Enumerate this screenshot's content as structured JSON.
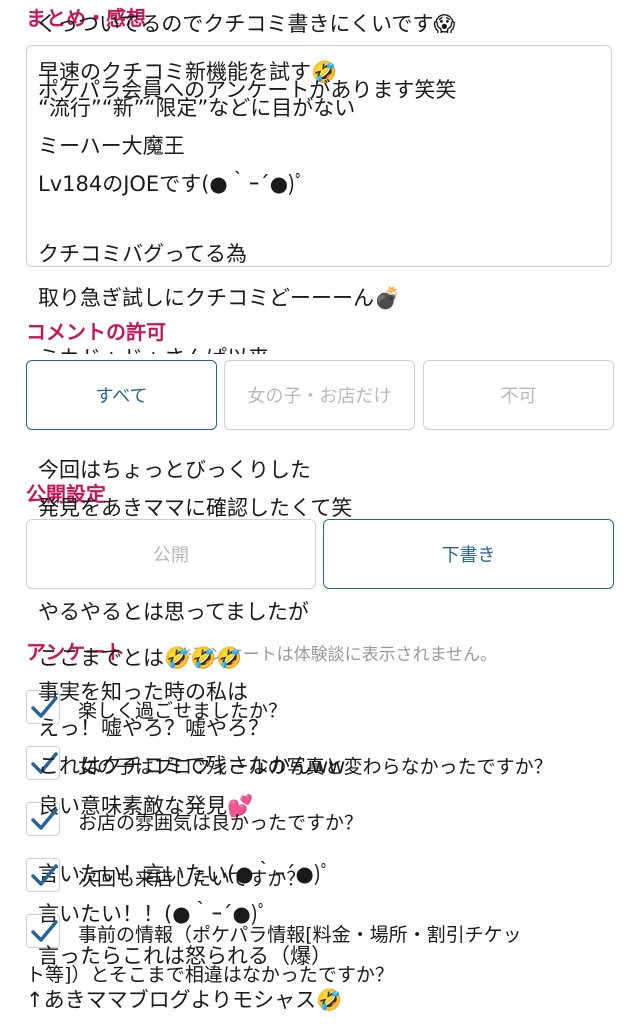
{
  "sections": {
    "summary_heading": "まとめ・感想",
    "comment_heading": "コメントの許可",
    "publish_heading": "公開設定",
    "survey_heading": "アンケート"
  },
  "review_lines": [
    "くっついてるのでクチコミ書きにくいです😱",
    "早速のクチコミ新機能を試す🤣",
    "ポケパラ会員へのアンケートがあります笑笑",
    "“流行”“新”“限定”などに目がない",
    "ミーハー大魔王",
    "Lv184のJOEです(●｀ｰ´●)ﾟ",
    "クチコミバグってる為",
    "取り急ぎ試しにクチコミどーーーん💣",
    "ミカドゥドゥさんぱ以来",
    "今回はちょっとびっくりした",
    "発見をあきママに確認したくて笑",
    "やるやるとは思ってましたが",
    "ここまでとは🤣🤣🤣",
    "事実を知った時の私は",
    "えっ！嘘やろ？嘘やろ？",
    "これはクチコミで残さなかんww",
    "良い意味素敵な発見💕",
    "言いたい！言いたい(●｀ｰ´●)ﾟ",
    "言いたい！！(●｀ｰ´●)ﾟ",
    "言ったらこれは怒られる（爆）",
    "↑あきママブログよりモシャス🤣"
  ],
  "comment_options": [
    "すべて",
    "女の子・お店だけ",
    "不可"
  ],
  "comment_selected": "すべて",
  "publish_options": [
    "公開",
    "下書き"
  ],
  "publish_selected": "下書き",
  "survey_note": "※アンケートは体験談に表示されません。",
  "survey_items": [
    {
      "text": "楽しく過ごせましたか？",
      "checked": true
    },
    {
      "text": "女の子はプロフィールの写真と変わらなかったですか？",
      "checked": true
    },
    {
      "text": "お店の雰囲気は良かったですか？",
      "checked": true
    },
    {
      "text": "次回も来店したいですか？",
      "checked": true
    },
    {
      "text": "事前の情報（ポケパラ情報[料金・場所・割引チケット等]）とそこまで相違はなかったですか？",
      "text_line1": "事前の情報（ポケパラ情報[料金・場所・割引チケッ",
      "text_line2": "ト等]）とそこまで相違はなかったですか？",
      "checked": true
    }
  ],
  "colors": {
    "accent": "#c2185b",
    "selected": "#2a6496",
    "check": "#2a6496"
  }
}
